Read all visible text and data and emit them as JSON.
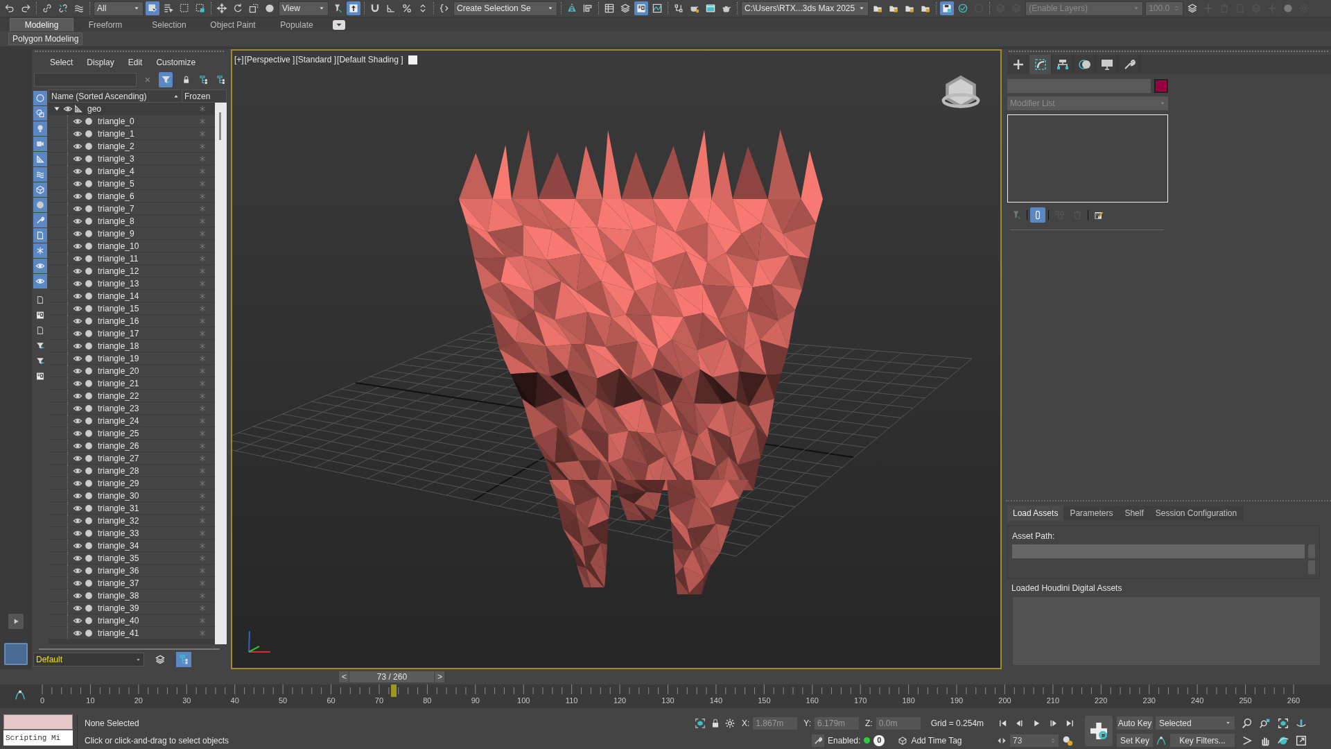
{
  "toolbar": [
    [
      {
        "kind": "icon",
        "on": false,
        "disabled": false
      },
      {
        "kind": "icon",
        "on": false,
        "disabled": false
      }
    ],
    [
      {
        "kind": "icon",
        "on": false,
        "disabled": false
      },
      {
        "kind": "icon",
        "on": false,
        "disabled": false
      },
      {
        "kind": "icon",
        "on": false,
        "disabled": false
      }
    ],
    [
      {
        "kind": "dropdown",
        "value": "All",
        "disabled": false
      },
      {
        "kind": "icon",
        "on": true,
        "disabled": false
      },
      {
        "kind": "icon",
        "on": false,
        "disabled": false
      },
      {
        "kind": "icon",
        "on": false,
        "disabled": false
      },
      {
        "kind": "icon",
        "on": false,
        "disabled": false
      }
    ],
    [
      {
        "kind": "icon",
        "on": false,
        "disabled": false
      },
      {
        "kind": "icon",
        "on": false,
        "disabled": false
      },
      {
        "kind": "icon",
        "on": false,
        "disabled": false
      },
      {
        "kind": "icon",
        "on": false,
        "disabled": false
      },
      {
        "kind": "dropdown",
        "value": "View",
        "disabled": false
      },
      {
        "kind": "icon",
        "on": false,
        "disabled": false
      },
      {
        "kind": "icon",
        "on": true,
        "disabled": false
      }
    ],
    [
      {
        "kind": "icon",
        "on": false,
        "disabled": false
      },
      {
        "kind": "icon",
        "on": false,
        "disabled": false
      },
      {
        "kind": "icon",
        "on": false,
        "disabled": false
      },
      {
        "kind": "icon",
        "on": false,
        "disabled": false
      }
    ],
    [
      {
        "kind": "icon",
        "on": false,
        "disabled": false
      },
      {
        "kind": "dropdown",
        "value": "Create Selection Se",
        "disabled": false
      }
    ],
    [
      {
        "kind": "icon",
        "on": false,
        "disabled": false
      },
      {
        "kind": "icon",
        "on": false,
        "disabled": false
      }
    ],
    [
      {
        "kind": "icon",
        "on": false,
        "disabled": false
      },
      {
        "kind": "icon",
        "on": false,
        "disabled": false
      },
      {
        "kind": "icon",
        "on": true,
        "disabled": false
      },
      {
        "kind": "icon",
        "on": false,
        "disabled": false
      }
    ],
    [
      {
        "kind": "icon",
        "on": false,
        "disabled": false
      },
      {
        "kind": "icon",
        "on": false,
        "disabled": false
      },
      {
        "kind": "icon",
        "on": false,
        "disabled": false
      },
      {
        "kind": "icon",
        "on": false,
        "disabled": false
      }
    ],
    [
      {
        "kind": "dropdown",
        "value": "C:\\Users\\RTX...3ds Max 2025",
        "disabled": false
      },
      {
        "kind": "icon",
        "on": false,
        "disabled": false
      },
      {
        "kind": "icon",
        "on": false,
        "disabled": false
      },
      {
        "kind": "icon",
        "on": false,
        "disabled": false
      },
      {
        "kind": "icon",
        "on": false,
        "disabled": false
      }
    ],
    [
      {
        "kind": "icon",
        "on": true,
        "disabled": false
      },
      {
        "kind": "icon",
        "on": false,
        "disabled": false
      },
      {
        "kind": "icon",
        "on": false,
        "disabled": true
      }
    ],
    [
      {
        "kind": "icon",
        "on": false,
        "disabled": true
      },
      {
        "kind": "icon",
        "on": false,
        "disabled": true
      },
      {
        "kind": "dropdown",
        "value": "(Enable Layers)",
        "disabled": true
      },
      {
        "kind": "spinner",
        "value": "100.0",
        "disabled": true
      },
      {
        "kind": "icon",
        "on": false,
        "disabled": false
      },
      {
        "kind": "icon",
        "on": false,
        "disabled": true
      },
      {
        "kind": "icon",
        "on": false,
        "disabled": true
      },
      {
        "kind": "icon",
        "on": false,
        "disabled": true
      },
      {
        "kind": "icon",
        "on": false,
        "disabled": true
      },
      {
        "kind": "icon",
        "on": false,
        "disabled": true
      },
      {
        "kind": "icon",
        "on": false,
        "disabled": true
      },
      {
        "kind": "icon",
        "on": false,
        "disabled": true
      }
    ]
  ],
  "ribbon": {
    "tabs": [
      {
        "label": "Modeling",
        "selected": true
      },
      {
        "label": "Freeform",
        "selected": false
      },
      {
        "label": "Selection",
        "selected": false
      },
      {
        "label": "Object Paint",
        "selected": false
      },
      {
        "label": "Populate",
        "selected": false
      }
    ],
    "panel": "Polygon Modeling"
  },
  "scene_explorer": {
    "menu": [
      "Select",
      "Display",
      "Edit",
      "Customize"
    ],
    "filter_toggle": {
      "on": true
    },
    "filters": [
      {
        "on": true
      },
      {
        "on": true
      },
      {
        "on": true
      },
      {
        "on": true
      },
      {
        "on": true
      },
      {
        "on": true
      },
      {
        "on": true
      },
      {
        "on": true
      },
      {
        "on": true
      },
      {
        "on": true
      },
      {
        "on": true
      },
      {
        "on": true
      },
      {
        "on": true
      },
      {
        "on": false
      },
      {
        "on": false
      },
      {
        "on": false
      },
      {
        "on": false
      },
      {
        "on": false
      },
      {
        "on": false
      }
    ],
    "columns": [
      "Name (Sorted Ascending)",
      "Frozen"
    ],
    "tree": [
      {
        "name": "geo",
        "expanded": true,
        "children": [
          {
            "name": "triangle_0"
          },
          {
            "name": "triangle_1"
          },
          {
            "name": "triangle_2"
          },
          {
            "name": "triangle_3"
          },
          {
            "name": "triangle_4"
          },
          {
            "name": "triangle_5"
          },
          {
            "name": "triangle_6"
          },
          {
            "name": "triangle_7"
          },
          {
            "name": "triangle_8"
          },
          {
            "name": "triangle_9"
          },
          {
            "name": "triangle_10"
          },
          {
            "name": "triangle_11"
          },
          {
            "name": "triangle_12"
          },
          {
            "name": "triangle_13"
          },
          {
            "name": "triangle_14"
          },
          {
            "name": "triangle_15"
          },
          {
            "name": "triangle_16"
          },
          {
            "name": "triangle_17"
          },
          {
            "name": "triangle_18"
          },
          {
            "name": "triangle_19"
          },
          {
            "name": "triangle_20"
          },
          {
            "name": "triangle_21"
          },
          {
            "name": "triangle_22"
          },
          {
            "name": "triangle_23"
          },
          {
            "name": "triangle_24"
          },
          {
            "name": "triangle_25"
          },
          {
            "name": "triangle_26"
          },
          {
            "name": "triangle_27"
          },
          {
            "name": "triangle_28"
          },
          {
            "name": "triangle_29"
          },
          {
            "name": "triangle_30"
          },
          {
            "name": "triangle_31"
          },
          {
            "name": "triangle_32"
          },
          {
            "name": "triangle_33"
          },
          {
            "name": "triangle_34"
          },
          {
            "name": "triangle_35"
          },
          {
            "name": "triangle_36"
          },
          {
            "name": "triangle_37"
          },
          {
            "name": "triangle_38"
          },
          {
            "name": "triangle_39"
          },
          {
            "name": "triangle_40"
          },
          {
            "name": "triangle_41"
          }
        ]
      }
    ],
    "layer": "Default",
    "layer_tools": [
      {
        "on": false
      },
      {
        "on": true
      }
    ]
  },
  "viewport": {
    "labels": [
      "[+]",
      "[Perspective ]",
      "[Standard ]",
      "[Default Shading ]"
    ]
  },
  "command_panel": {
    "tabs": [
      {
        "selected": false
      },
      {
        "selected": true
      },
      {
        "selected": false
      },
      {
        "selected": false
      },
      {
        "selected": false
      },
      {
        "selected": false
      }
    ],
    "color": "#990040",
    "modifier_list": "Modifier List",
    "stack_tools": [
      {
        "on": false,
        "disabled": true
      },
      {
        "on": true,
        "disabled": false
      },
      {
        "on": false,
        "disabled": true
      },
      {
        "on": false,
        "disabled": true
      },
      {
        "on": false,
        "disabled": false
      }
    ]
  },
  "houdini": {
    "tabs": [
      {
        "label": "Load Assets",
        "selected": true
      },
      {
        "label": "Parameters",
        "selected": false
      },
      {
        "label": "Shelf",
        "selected": false
      },
      {
        "label": "Session Configuration",
        "selected": false
      }
    ],
    "asset_path_label": "Asset Path:",
    "loaded_label": "Loaded Houdini Digital Assets"
  },
  "time_slider": {
    "prev": "<",
    "frame": "73 / 260",
    "next": ">",
    "level": 0.2808
  },
  "track_bar": {
    "labels": [
      "0",
      "10",
      "20",
      "30",
      "40",
      "50",
      "60",
      "70",
      "80",
      "90",
      "100",
      "110",
      "120",
      "130",
      "140",
      "150",
      "160",
      "170",
      "180",
      "190",
      "200",
      "210",
      "220",
      "230",
      "240",
      "250",
      "260"
    ],
    "level": 0.2808
  },
  "status": {
    "listener": "Scripting Mi",
    "selection": "None Selected",
    "prompt": "Click or click-and-drag to select objects",
    "x_label": "X:",
    "x": "1.867m",
    "y_label": "Y:",
    "y": "6.179m",
    "z_label": "Z:",
    "z": "0.0m",
    "grid": "Grid = 0.254m",
    "enabled_label": "Enabled:",
    "enabled": true,
    "time_tag_count": "0",
    "add_time_tag": "Add Time Tag"
  },
  "playback": {
    "frame": "73",
    "auto_key": "Auto Key",
    "key_mode": "Selected",
    "set_key": "Set Key",
    "key_filters": "Key Filters..."
  }
}
